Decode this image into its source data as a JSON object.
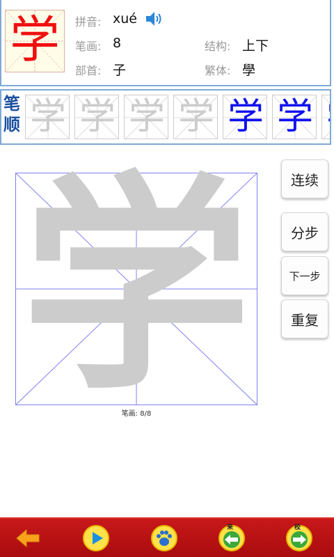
{
  "character": {
    "glyph": "学",
    "pinyin_label": "拼音:",
    "pinyin": "xué",
    "strokes_label": "笔画:",
    "strokes": "8",
    "structure_label": "结构:",
    "structure": "上下",
    "radical_label": "部首:",
    "radical": "子",
    "traditional_label": "繁体:",
    "traditional": "學"
  },
  "stroke_order": {
    "title_line1": "笔",
    "title_line2": "顺",
    "frames": [
      "学",
      "学",
      "学",
      "学",
      "学",
      "学",
      "学"
    ]
  },
  "writing": {
    "ghost_glyph": "学",
    "stroke_counter": "笔画:  8/8"
  },
  "side_buttons": {
    "continuous": "连续",
    "step": "分步",
    "next_step": "下一步",
    "repeat": "重复"
  },
  "toolbar": {
    "prev_tag": "来",
    "next_tag": "校",
    "icons": [
      "back-arrow-icon",
      "play-icon",
      "paw-icon",
      "prev-char-icon",
      "next-char-icon"
    ]
  },
  "colors": {
    "accent_red": "#f01010",
    "stroke_blue": "#1010ee",
    "toolbar_red": "#b81214",
    "ghost_gray": "#cccccc"
  }
}
